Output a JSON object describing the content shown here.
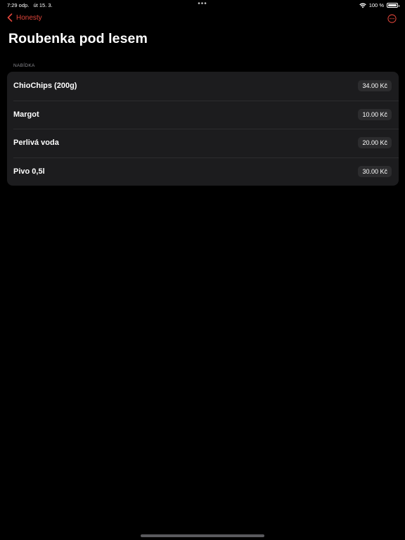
{
  "status_bar": {
    "time": "7:29 odp.",
    "date": "út 15. 3.",
    "multitask_dots": "•••",
    "battery_text": "100 %",
    "wifi_icon": "wifi-icon",
    "battery_icon": "battery-icon"
  },
  "nav": {
    "back_label": "Honesty",
    "back_icon": "chevron-left-icon",
    "more_icon": "ellipsis-circle-icon",
    "accent_color": "#e0453a"
  },
  "title": "Roubenka pod lesem",
  "section": {
    "header": "NABÍDKA",
    "items": [
      {
        "name": "ChioChips (200g)",
        "price": "34.00 Kč"
      },
      {
        "name": "Margot",
        "price": "10.00 Kč"
      },
      {
        "name": "Perlivá voda",
        "price": "20.00 Kč"
      },
      {
        "name": "Pivo 0,5l",
        "price": "30.00 Kč"
      }
    ]
  }
}
